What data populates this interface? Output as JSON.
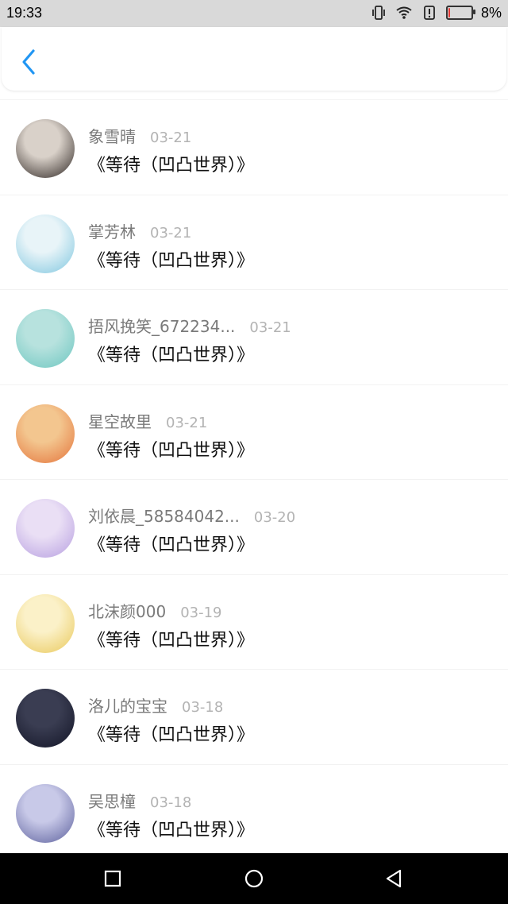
{
  "status": {
    "time": "19:33",
    "battery_text": "8%",
    "battery_level": 0.08
  },
  "header": {
    "back_icon": "chevron-left-icon",
    "accent": "#2196F3"
  },
  "items": [
    {
      "name": "象雪晴",
      "date": "03-21",
      "title": "《等待（凹凸世界）》",
      "avatar_colors": [
        "#d9d1c9",
        "#2b2320"
      ]
    },
    {
      "name": "掌芳林",
      "date": "03-21",
      "title": "《等待（凹凸世界）》",
      "avatar_colors": [
        "#e8f4f8",
        "#7ec6df"
      ]
    },
    {
      "name": "捂风挽笑_672234...",
      "date": "03-21",
      "title": "《等待（凹凸世界）》",
      "avatar_colors": [
        "#b7e2de",
        "#6cc6c0"
      ]
    },
    {
      "name": "星空故里",
      "date": "03-21",
      "title": "《等待（凹凸世界）》",
      "avatar_colors": [
        "#f3c68f",
        "#e4733a"
      ]
    },
    {
      "name": "刘依晨_58584042...",
      "date": "03-20",
      "title": "《等待（凹凸世界）》",
      "avatar_colors": [
        "#eadff5",
        "#b69ee0"
      ]
    },
    {
      "name": "北沫颜000",
      "date": "03-19",
      "title": "《等待（凹凸世界）》",
      "avatar_colors": [
        "#fbf1c8",
        "#e9c85a"
      ]
    },
    {
      "name": "洛儿的宝宝",
      "date": "03-18",
      "title": "《等待（凹凸世界）》",
      "avatar_colors": [
        "#3a3d52",
        "#121426"
      ]
    },
    {
      "name": "吴思橦",
      "date": "03-18",
      "title": "《等待（凹凸世界）》",
      "avatar_colors": [
        "#c8c9e8",
        "#5b5f9c"
      ]
    }
  ],
  "nav": {
    "recent_icon": "square-icon",
    "home_icon": "circle-icon",
    "back_icon": "triangle-back-icon"
  }
}
